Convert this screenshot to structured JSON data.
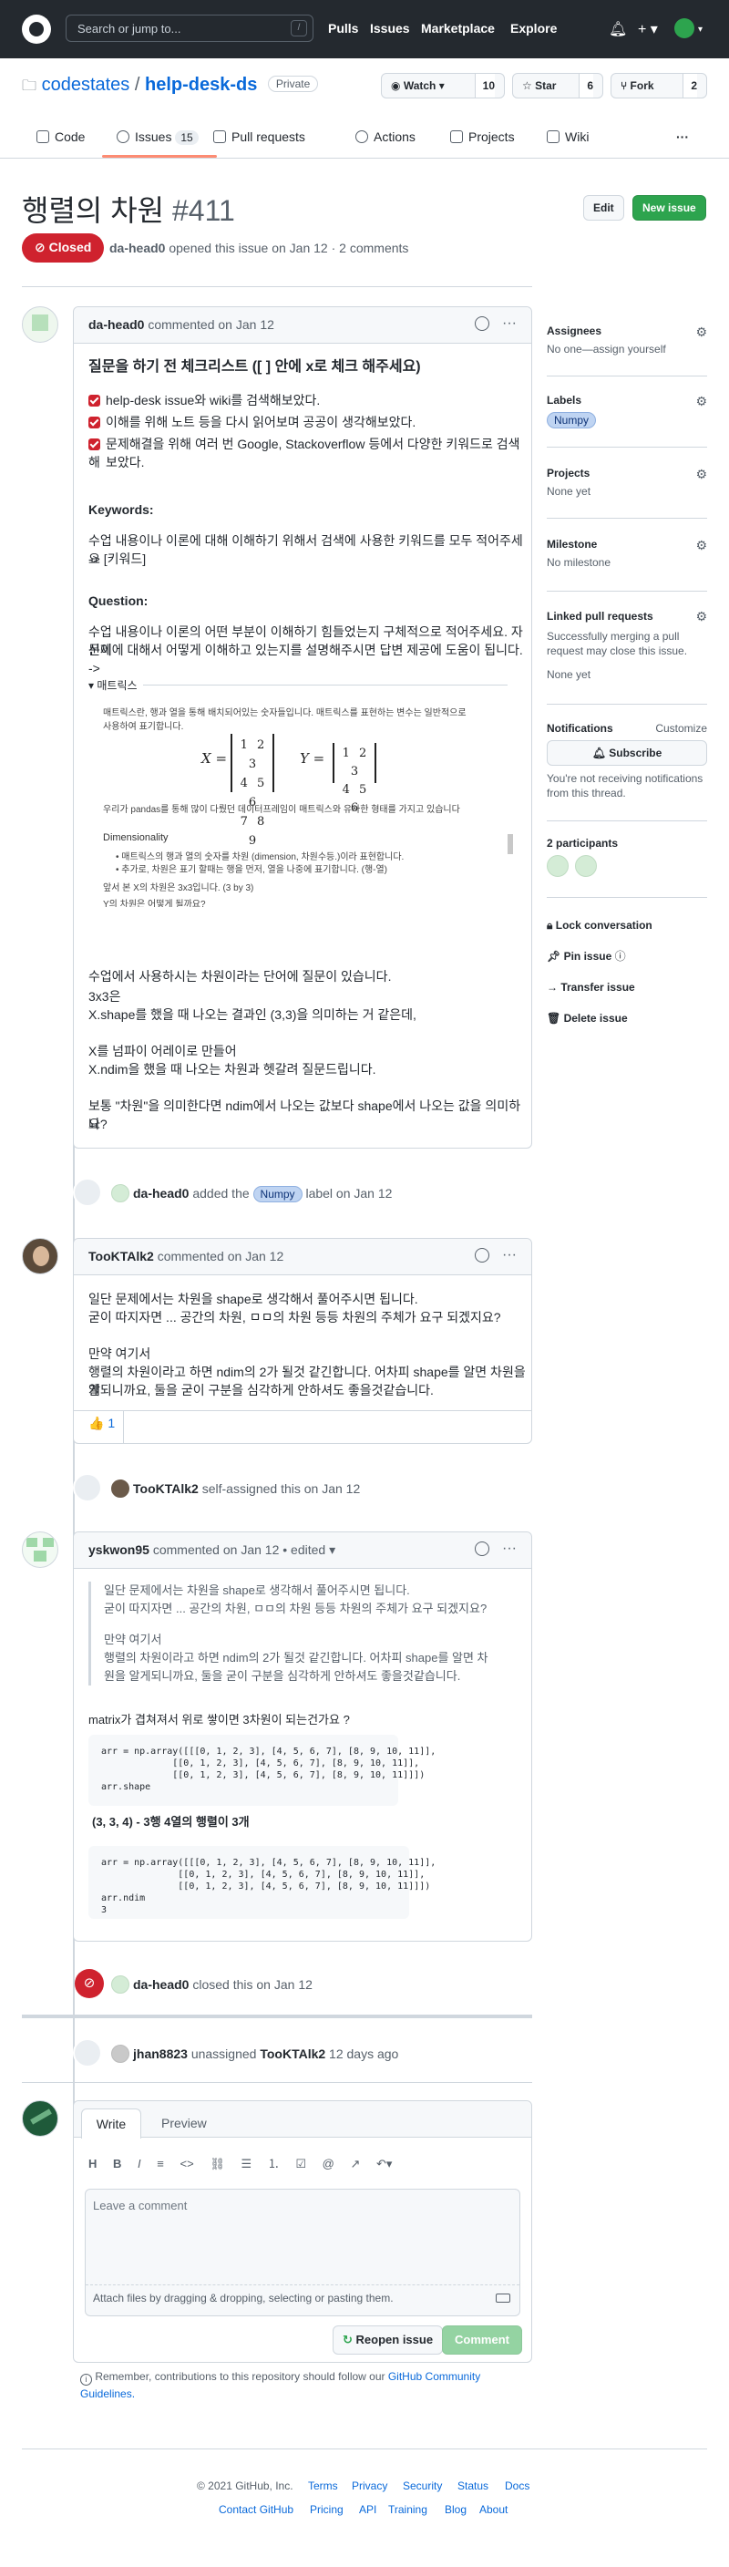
{
  "header": {
    "search_placeholder": "Search or jump to...",
    "slash_key": "/",
    "nav": [
      "Pulls",
      "Issues",
      "Marketplace",
      "Explore"
    ]
  },
  "repo": {
    "owner": "codestates",
    "sep": "/",
    "name": "help-desk-ds",
    "visibility": "Private",
    "watch_label": "Watch",
    "watch_count": "10",
    "star_label": "Star",
    "star_count": "6",
    "fork_label": "Fork",
    "fork_count": "2"
  },
  "tabs": [
    {
      "label": "Code"
    },
    {
      "label": "Issues",
      "count": "15"
    },
    {
      "label": "Pull requests"
    },
    {
      "label": "Actions"
    },
    {
      "label": "Projects"
    },
    {
      "label": "Wiki"
    }
  ],
  "issue": {
    "title": "행렬의 차원",
    "number": "#411",
    "edit_label": "Edit",
    "new_issue_label": "New issue",
    "state": "Closed",
    "author": "da-head0",
    "meta_text": "opened this issue on Jan 12 · 2 comments"
  },
  "comment1": {
    "author": "da-head0",
    "meta": "commented on Jan 12",
    "heading": "질문을 하기 전 체크리스트 ([ ] 안에 x로 체크 해주세요)",
    "checks": [
      "help-desk issue와 wiki를 검색해보았다.",
      "이해를 위해 노트 등을 다시 읽어보며 공공이 생각해보았다.",
      "문제해결을 위해 여러 번 Google, Stackoverflow 등에서 다양한 키워드로 검색해",
      "보았다."
    ],
    "keywords_h": "Keywords:",
    "keywords_p1": "수업 내용이나 이론에 대해 이해하기 위해서 검색에 사용한 키워드를 모두 적어주세요",
    "keywords_p2": "-> [키워드]",
    "question_h": "Question:",
    "question_p1": "수업 내용이나 이론의 어떤 부분이 이해하기 힘들었는지 구체적으로 적어주세요. 자신이",
    "question_p2": "문제에 대해서 어떻게 이해하고 있는지를 설명해주시면 답변 제공에 도움이 됩니다.",
    "question_p3": "->",
    "embed_title": "매트릭스",
    "embed_p1": "매트릭스란, 행과 열을 통해 배치되어있는 숫자들입니다. 매트릭스를 표현하는 변수는 일반적으로",
    "embed_p2": "사용하여 표기합니다.",
    "embed_p3": "우리가 pandas를 통해 많이 다뤘던 데이터프레임이 매트릭스와 유사한 형태를 가지고 있습니다",
    "embed_dim_h": "Dimensionality",
    "embed_bullet1": "매트릭스의 행과 열의 숫자를 차원 (dimension, 차원수등.)이라 표현합니다.",
    "embed_bullet2": "추가로, 차원은 표기 할때는 행을 먼저, 열을 나중에 표기합니다. (행-열)",
    "embed_p4": "앞서 본 X의 차원은 3x3입니다. (3 by 3)",
    "embed_p5": "Y의 차원은 어떻게 될까요?",
    "matrix_x_label": "X =",
    "matrix_x": "1 2 3 / 4 5 6 / 7 8 9",
    "matrix_y_label": "Y =",
    "matrix_y": "1 2 3 / 4 5 6",
    "p_a": "수업에서 사용하시는 차원이라는 단어에 질문이 있습니다.",
    "p_b": "3x3은",
    "p_c": "X.shape를 했을 때 나오는 결과인 (3,3)을 의미하는 거 같은데,",
    "p_d": "X를 넘파이 어레이로 만들어",
    "p_e": "X.ndim을 했을 때 나오는 차원과 헷갈려 질문드립니다.",
    "p_f": "보통 \"차원\"을 의미한다면 ndim에서 나오는 값보다 shape에서 나오는 값을 의미하나",
    "p_g": "요?"
  },
  "event_label": {
    "actor": "da-head0",
    "text1": "added the",
    "label": "Numpy",
    "text2": "label on Jan 12"
  },
  "comment2": {
    "author": "TooKTAlk2",
    "meta": "commented on Jan 12",
    "l1": "일단 문제에서는 차원을 shape로 생각해서 풀어주시면 됩니다.",
    "l2": "굳이 따지자면 ... 공간의 차원, ㅁㅁ의 차원 등등 차원의 주체가 요구 되겠지요?",
    "l3": "만약 여기서",
    "l4": "행렬의 차원이라고 하면 ndim의 2가 될것 같긴합니다. 어차피 shape를 알면 차원을 알",
    "l5": "게되니까요, 둘을 굳이 구분을 심각하게 안하셔도 좋을것같습니다.",
    "reaction": "👍",
    "reaction_count": "1"
  },
  "event_assign": {
    "actor": "TooKTAlk2",
    "text": "self-assigned this on Jan 12"
  },
  "comment3": {
    "author": "yskwon95",
    "meta": "commented on Jan 12 • edited",
    "q1": "일단 문제에서는 차원을 shape로 생각해서 풀어주시면 됩니다.",
    "q2": "굳이 따지자면 ... 공간의 차원, ㅁㅁ의 차원 등등 차원의 주체가 요구 되겠지요?",
    "q3": "만약 여기서",
    "q4": "행렬의 차원이라고 하면 ndim의 2가 될것 같긴합니다. 어차피 shape를 알면 차",
    "q5": "원을 알게되니까요, 둘을 굳이 구분을 심각하게 안하셔도 좋을것같습니다.",
    "p1": "matrix가 겹쳐져서 위로 쌓이면 3차원이 되는건가요 ?",
    "code1": "arr = np.array([[[0, 1, 2, 3], [4, 5, 6, 7], [8, 9, 10, 11]],\n             [[0, 1, 2, 3], [4, 5, 6, 7], [8, 9, 10, 11]],\n             [[0, 1, 2, 3], [4, 5, 6, 7], [8, 9, 10, 11]]])\narr.shape",
    "p2": "(3, 3, 4) - 3행 4열의 행렬이 3개",
    "code2": "arr = np.array([[[0, 1, 2, 3], [4, 5, 6, 7], [8, 9, 10, 11]],\n              [[0, 1, 2, 3], [4, 5, 6, 7], [8, 9, 10, 11]],\n              [[0, 1, 2, 3], [4, 5, 6, 7], [8, 9, 10, 11]]])\narr.ndim\n3"
  },
  "event_closed": {
    "actor": "da-head0",
    "text": "closed this on Jan 12"
  },
  "event_unassign": {
    "actor": "jhan8823",
    "text1": "unassigned",
    "target": "TooKTAlk2",
    "text2": "12 days ago"
  },
  "composer": {
    "write_tab": "Write",
    "preview_tab": "Preview",
    "placeholder": "Leave a comment",
    "attach_text": "Attach files by dragging & dropping, selecting or pasting them.",
    "reopen_label": "Reopen issue",
    "comment_label": "Comment",
    "note": "Remember, contributions to this repository should follow our",
    "note_link": "GitHub Community",
    "note_link2": "Guidelines."
  },
  "sidebar": {
    "assignees_h": "Assignees",
    "assignees_v": "No one—assign yourself",
    "labels_h": "Labels",
    "labels_v": "Numpy",
    "projects_h": "Projects",
    "projects_v": "None yet",
    "milestone_h": "Milestone",
    "milestone_v": "No milestone",
    "linked_h": "Linked pull requests",
    "linked_v1": "Successfully merging a pull",
    "linked_v2": "request may close this issue.",
    "linked_v3": "None yet",
    "notif_h": "Notifications",
    "notif_customize": "Customize",
    "subscribe": "Subscribe",
    "notif_note1": "You're not receiving notifications",
    "notif_note2": "from this thread.",
    "participants": "2 participants",
    "lock": "Lock conversation",
    "pin": "Pin issue",
    "transfer": "Transfer issue",
    "delete": "Delete issue"
  },
  "footer": {
    "copyright": "© 2021 GitHub, Inc.",
    "links1": [
      "Terms",
      "Privacy",
      "Security",
      "Status",
      "Docs"
    ],
    "links2": [
      "Contact GitHub",
      "Pricing",
      "API",
      "Training",
      "Blog",
      "About"
    ]
  }
}
